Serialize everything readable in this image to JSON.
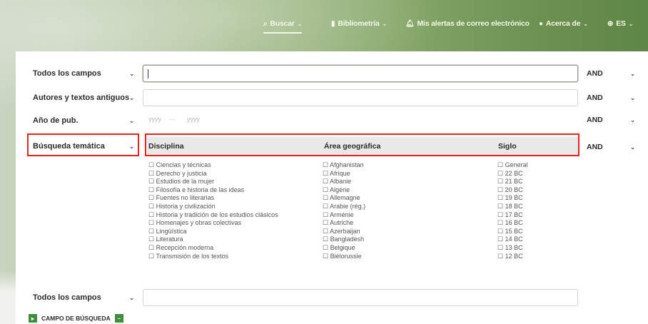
{
  "nav": {
    "search": "Buscar",
    "search_icon": "magnifier",
    "bibliometrics": "Bibliometría",
    "bibliometrics_icon": "bar-chart",
    "alerts": "Mis alertas de correo electrónico",
    "alerts_icon": "bell",
    "about": "Acerca de",
    "about_icon": "info",
    "lang": "ES",
    "lang_icon": "globe"
  },
  "rows": [
    {
      "field": "Todos los campos",
      "op": "AND",
      "value": ""
    },
    {
      "field": "Autores y textos antiguos",
      "op": "AND",
      "value": ""
    },
    {
      "field": "Año de pub.",
      "op": "AND",
      "from_placeholder": "yyyy",
      "to_placeholder": "yyyy"
    },
    {
      "field": "Búsqueda temática",
      "op": "AND"
    },
    {
      "field": "Todos los campos",
      "value": ""
    }
  ],
  "thematic": {
    "headers": [
      "Disciplina",
      "Área geográfica",
      "Siglo"
    ],
    "disciplina": [
      "Ciencias y técnicas",
      "Derecho y justicia",
      "Estudios de la mujer",
      "Filosofía e historia de las ideas",
      "Fuentes no literarias",
      "Historia y civilización",
      "Historia y tradición de los estudios clásicos",
      "Homenajes y obras colectivas",
      "Lingüística",
      "Literatura",
      "Recepción moderna",
      "Transmisión de los textos"
    ],
    "area": [
      "Afghanistan",
      "Afrique",
      "Albanie",
      "Algérie",
      "Allemagne",
      "Arabie (rég.)",
      "Arménie",
      "Autriche",
      "Azerbaijan",
      "Bangladesh",
      "Belgique",
      "Biélorussie"
    ],
    "siglo": [
      "General",
      "22 BC",
      "21 BC",
      "20 BC",
      "19 BC",
      "18 BC",
      "17 BC",
      "16 BC",
      "15 BC",
      "14 BC",
      "13 BC",
      "12 BC"
    ]
  },
  "add_field": "CAMPO DE BÚSQUEDA",
  "colors": {
    "accent": "#3f8f3a",
    "highlight": "#e0261a"
  }
}
